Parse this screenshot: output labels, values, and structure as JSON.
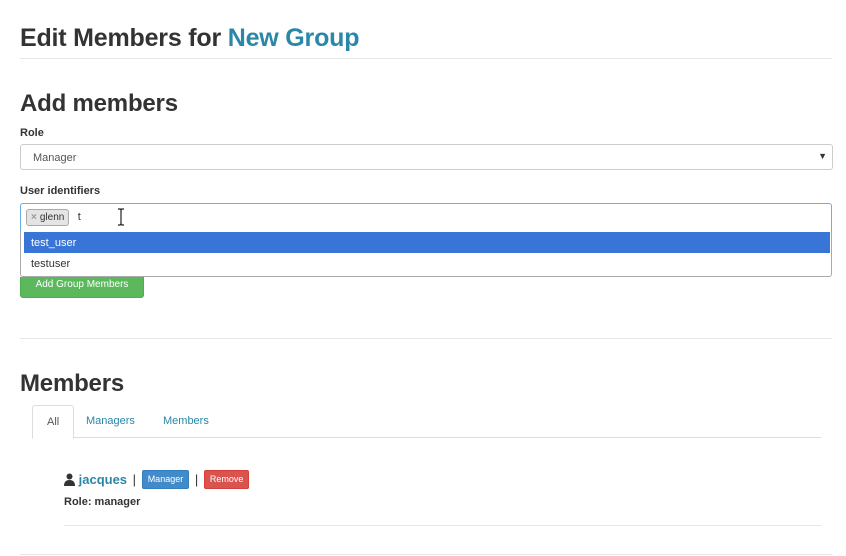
{
  "header": {
    "title_prefix": "Edit Members for",
    "group_name": "New Group"
  },
  "add_members": {
    "heading": "Add members",
    "role_label": "Role",
    "role_value": "Manager",
    "identifiers_label": "User identifiers",
    "tags": [
      {
        "label": "glenn"
      }
    ],
    "typed_text": "t",
    "suggestions": [
      {
        "label": "test_user",
        "highlighted": true
      },
      {
        "label": "testuser",
        "highlighted": false
      }
    ],
    "submit_label": "Add Group Members"
  },
  "members": {
    "heading": "Members",
    "tabs": [
      {
        "label": "All",
        "active": true
      },
      {
        "label": "Managers",
        "active": false
      },
      {
        "label": "Members",
        "active": false
      }
    ],
    "list": [
      {
        "name": "jacques",
        "badge": "Manager",
        "remove_label": "Remove",
        "role_text": "Role: manager"
      }
    ]
  },
  "colors": {
    "link": "#2a87a8",
    "success": "#5cb85c",
    "primary": "#428bca",
    "danger": "#d9534f",
    "highlight": "#3875d7"
  }
}
